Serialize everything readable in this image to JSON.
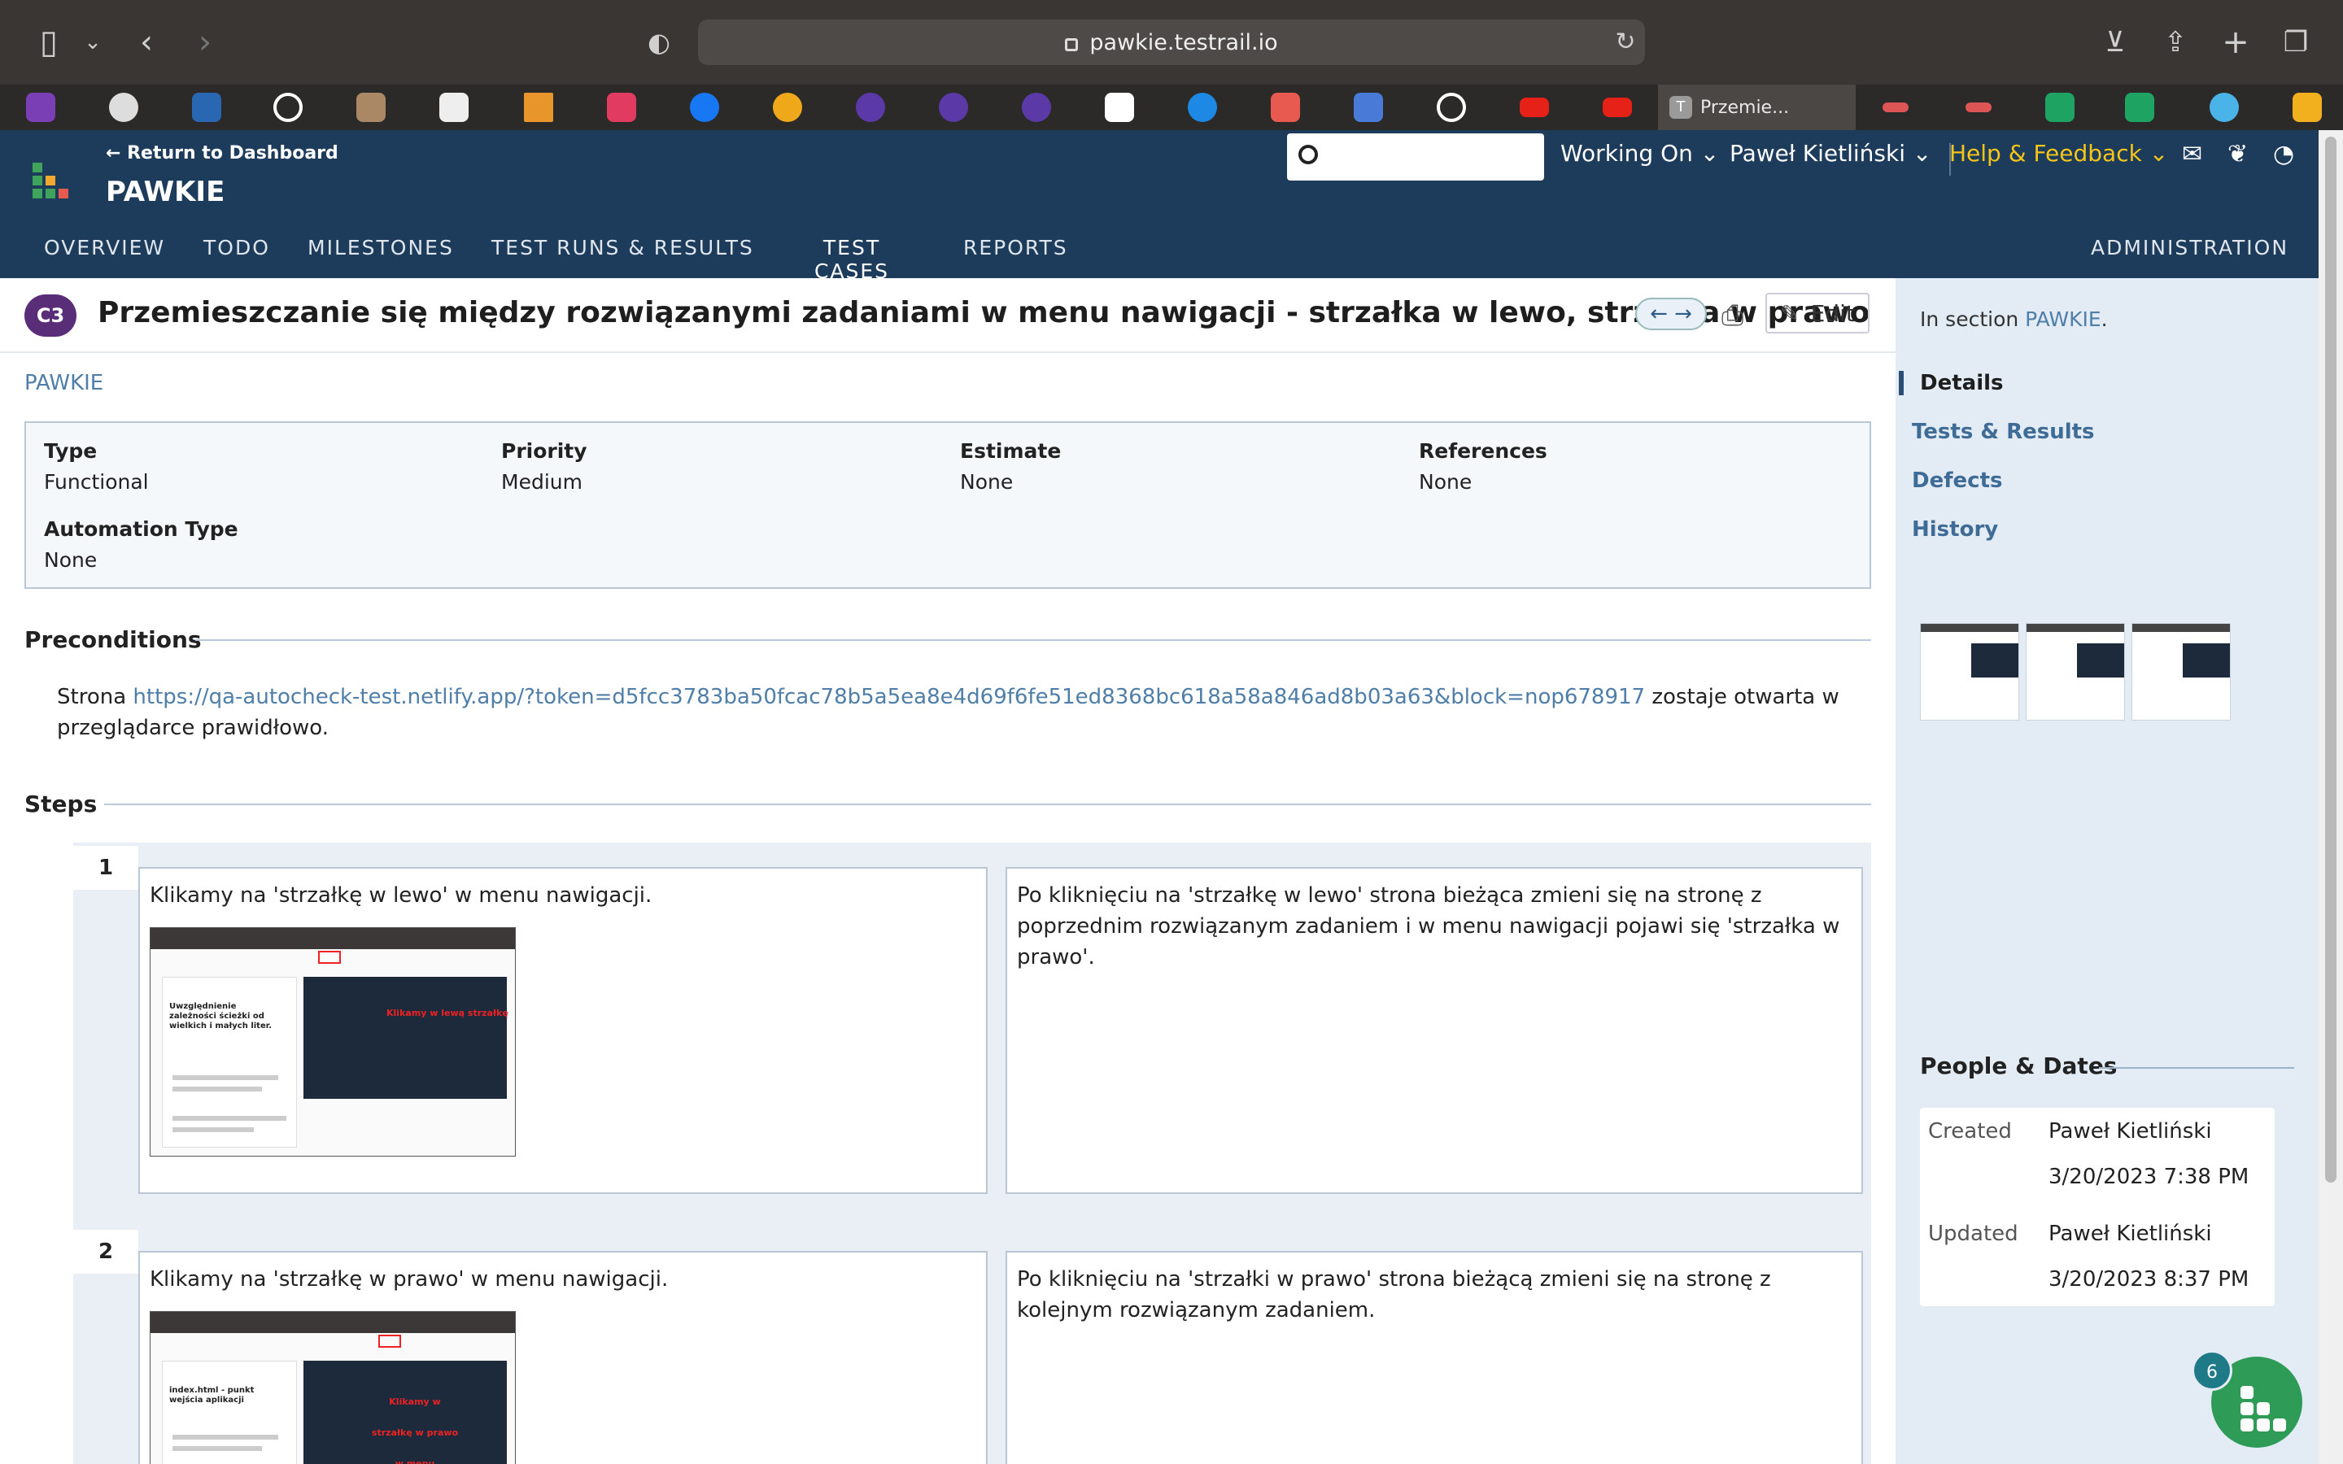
{
  "browser": {
    "url": "pawkie.testrail.io",
    "active_tab": "Przemie...",
    "active_tab_favicon": "T"
  },
  "header": {
    "return_link": "← Return to Dashboard",
    "project": "PAWKIE",
    "search_placeholder": "",
    "working_on": "Working On",
    "user": "Paweł Kietliński",
    "help": "Help & Feedback"
  },
  "nav": {
    "tabs": [
      "OVERVIEW",
      "TODO",
      "MILESTONES",
      "TEST RUNS & RESULTS",
      "TEST CASES",
      "REPORTS"
    ],
    "active": "TEST CASES",
    "admin": "ADMINISTRATION"
  },
  "case": {
    "id": "C3",
    "title": "Przemieszczanie się między rozwiązanymi zadaniami w menu nawigacji - strzałka w lewo, strzałka w prawo",
    "edit_label": "Edit",
    "section_link": "PAWKIE",
    "fields": {
      "type_label": "Type",
      "type": "Functional",
      "priority_label": "Priority",
      "priority": "Medium",
      "estimate_label": "Estimate",
      "estimate": "None",
      "references_label": "References",
      "references": "None",
      "automation_label": "Automation Type",
      "automation": "None"
    },
    "preconditions_heading": "Preconditions",
    "precondition_prefix": "Strona ",
    "precondition_link": "https://qa-autocheck-test.netlify.app/?token=d5fcc3783ba50fcac78b5a5ea8e4d69f6fe51ed8368bc618a58a846ad8b03a63&block=nop678917",
    "precondition_suffix": " zostaje otwarta w przeglądarce prawidłowo.",
    "steps_heading": "Steps",
    "steps": [
      {
        "num": "1",
        "action": "Klikamy na 'strzałkę w lewo' w menu nawigacji.",
        "expected": "Po kliknięciu na 'strzałkę w lewo' strona bieżąca zmieni się na stronę z poprzednim rozwiązanym zadaniem i w menu nawigacji pojawi się 'strzałka w prawo'.",
        "thumb_heading": "Uwzględnienie zależności ścieżki od wielkich i małych liter.",
        "thumb_note": "Klikamy w lewą strzałkę"
      },
      {
        "num": "2",
        "action": "Klikamy na 'strzałkę w prawo' w menu nawigacji.",
        "expected": "Po kliknięciu na 'strzałki w prawo' strona bieżącą zmieni się na stronę z kolejnym rozwiązanym zadaniem.",
        "thumb_heading": "index.html - punkt wejścia aplikacji",
        "thumb_note": "Klikamy w strzałkę w prawo w menu nawigacji"
      }
    ]
  },
  "sidebar": {
    "in_section_prefix": "In section ",
    "in_section_link": "PAWKIE",
    "links": [
      "Details",
      "Tests & Results",
      "Defects",
      "History"
    ],
    "people_dates_heading": "People & Dates",
    "created_label": "Created",
    "created_by": "Paweł Kietliński",
    "created_at": "3/20/2023 7:38 PM",
    "updated_label": "Updated",
    "updated_by": "Paweł Kietliński",
    "updated_at": "3/20/2023 8:37 PM"
  },
  "fab": {
    "badge": "6"
  },
  "colors": {
    "header_bg": "#1d3b5b",
    "link": "#4f7ea8",
    "help": "#f5c518",
    "sidebar_bg": "#e3ecf4",
    "case_badge": "#5a2d78"
  }
}
